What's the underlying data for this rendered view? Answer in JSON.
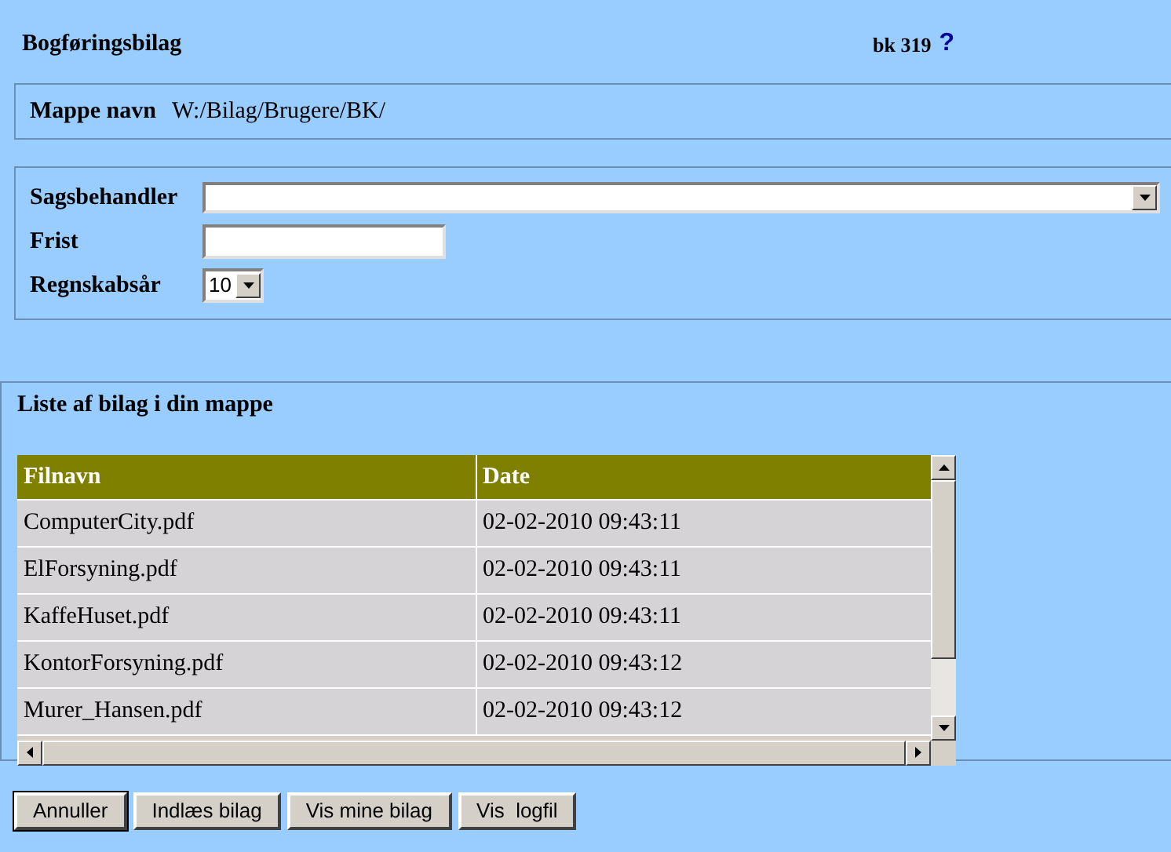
{
  "header": {
    "title": "Bogføringsbilag",
    "code": "bk 319",
    "help": "?"
  },
  "folder": {
    "label": "Mappe navn",
    "value": "W:/Bilag/Brugere/BK/"
  },
  "form": {
    "fields": [
      {
        "kind": "select",
        "label": "Sagsbehandler"
      },
      {
        "kind": "text",
        "label": "Frist"
      },
      {
        "kind": "smallselect",
        "label": "Regnskabsår",
        "value": "10"
      }
    ]
  },
  "list": {
    "title": "Liste af bilag i din mappe",
    "columns": [
      "Filnavn",
      "Date"
    ],
    "rows": [
      [
        "ComputerCity.pdf",
        "02-02-2010 09:43:11"
      ],
      [
        "ElForsyning.pdf",
        "02-02-2010 09:43:11"
      ],
      [
        "KaffeHuset.pdf",
        "02-02-2010 09:43:11"
      ],
      [
        "KontorForsyning.pdf",
        "02-02-2010 09:43:12"
      ],
      [
        "Murer_Hansen.pdf",
        "02-02-2010 09:43:12"
      ]
    ]
  },
  "buttons": [
    {
      "label": "Annuller",
      "selected": true
    },
    {
      "label": "Indlæs bilag",
      "selected": false
    },
    {
      "label": "Vis mine bilag",
      "selected": false
    },
    {
      "label": "Vis  logfil",
      "selected": false
    }
  ]
}
